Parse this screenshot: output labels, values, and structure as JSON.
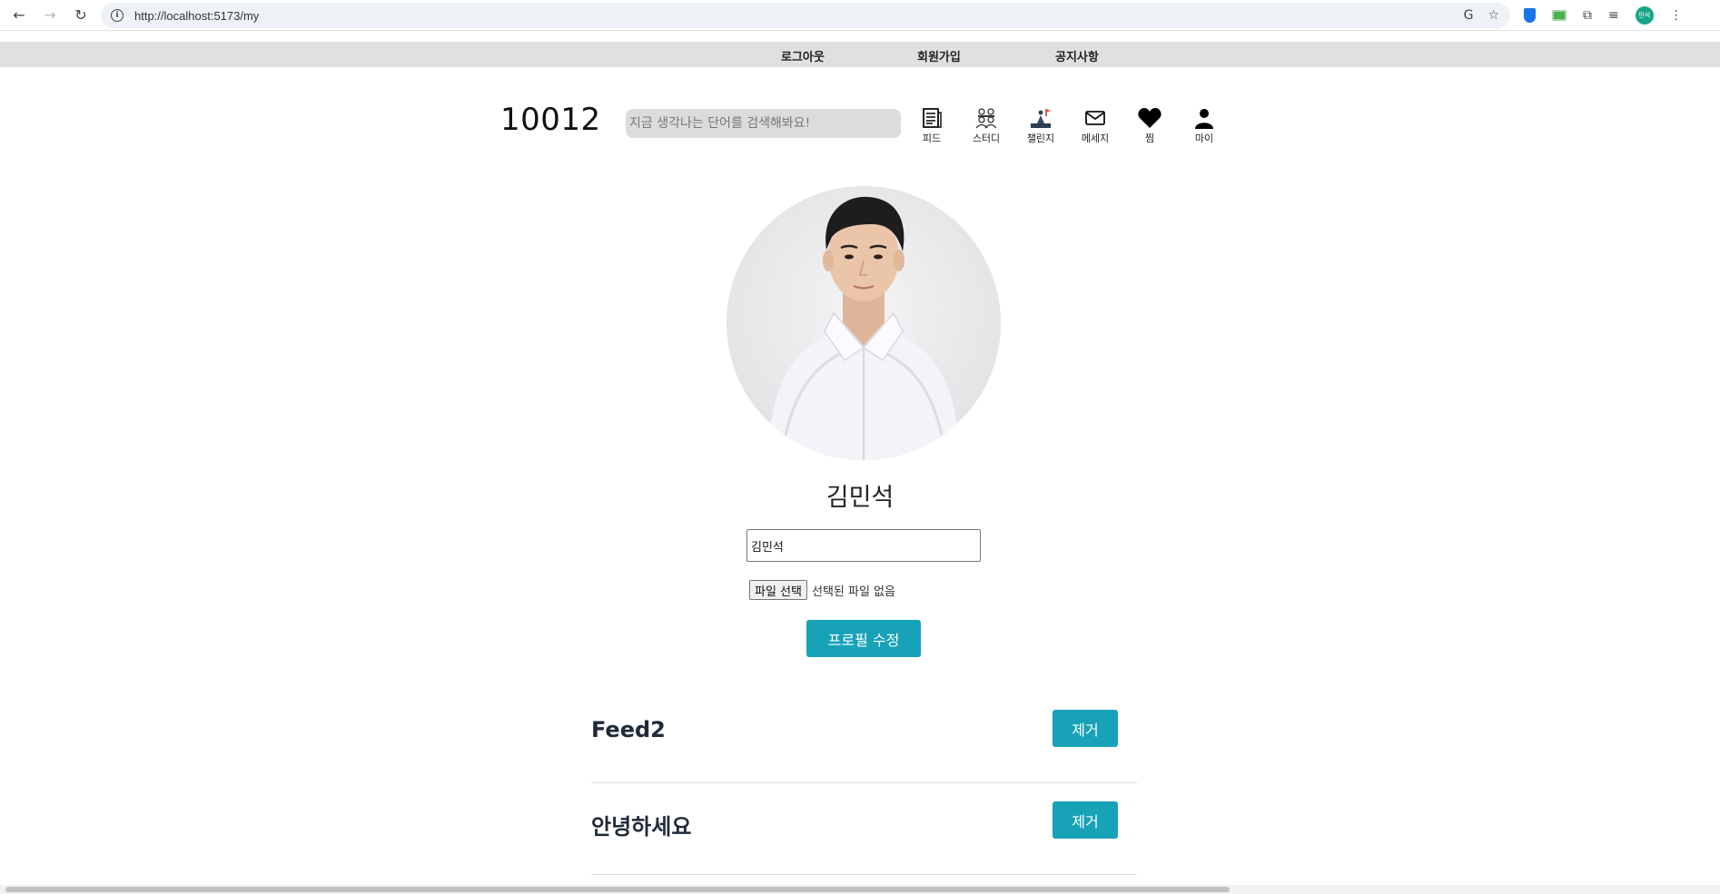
{
  "browser": {
    "url": "http://localhost:5173/my",
    "back_icon": "←",
    "forward_icon": "→",
    "reload_icon": "↻",
    "info_icon": "i",
    "translate_icon": "G",
    "star_icon": "☆",
    "puzzle_icon": "⧉",
    "media_icon": "≡",
    "profile_chip": "민석",
    "menu_icon": "⋮"
  },
  "topnav": {
    "logout": "로그아웃",
    "signup": "회원가입",
    "notice": "공지사항"
  },
  "header": {
    "logo": "10012",
    "search_placeholder": "지금 생각나는 단어를 검색해봐요!",
    "menu": [
      {
        "label": "피드",
        "icon": "newspaper-icon"
      },
      {
        "label": "스터디",
        "icon": "group-icon"
      },
      {
        "label": "챌린지",
        "icon": "challenge-icon"
      },
      {
        "label": "메세지",
        "icon": "mail-icon"
      },
      {
        "label": "찜",
        "icon": "heart-icon"
      },
      {
        "label": "마이",
        "icon": "user-icon"
      }
    ]
  },
  "profile": {
    "name": "김민석",
    "name_input_value": "김민석",
    "file_button": "파일 선택",
    "file_status": "선택된 파일 없음",
    "submit_label": "프로필 수정"
  },
  "feeds": [
    {
      "title": "Feed2",
      "remove_label": "제거"
    },
    {
      "title": "안녕하세요",
      "remove_label": "제거"
    }
  ],
  "colors": {
    "accent": "#17a2b8",
    "topnav_bg": "#e0e0e0",
    "search_bg": "#dcdcdc"
  }
}
